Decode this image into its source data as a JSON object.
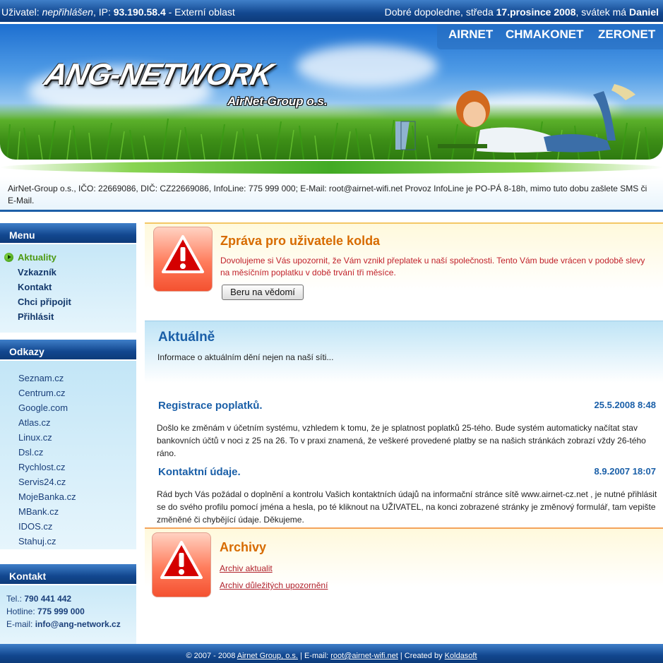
{
  "topbar": {
    "user_label": "Uživatel:",
    "user_value": "nepřihlášen",
    "ip_label": ", IP:",
    "ip_value": "93.190.58.4",
    "zone": "- Externí oblast",
    "greeting": "Dobré dopoledne, středa",
    "date": "17.prosince 2008",
    "nameday_label": ", svátek má",
    "nameday": "Daniel"
  },
  "header": {
    "logo": "ANG-NETWORK",
    "sublogo": "AirNet-Group o.s.",
    "nav": [
      "AIRNET",
      "CHMAKONET",
      "ZERONET"
    ]
  },
  "info": {
    "text": "AirNet-Group o.s., IČO: 22669086, DIČ: CZ22669086, InfoLine: 775 999 000; E-Mail: root@airnet-wifi.net Provoz InfoLine je PO-PÁ 8-18h, mimo tuto dobu zašlete SMS či E-Mail."
  },
  "sidebar": {
    "menu": {
      "title": "Menu",
      "items": [
        "Aktuality",
        "Vzkazník",
        "Kontakt",
        "Chci připojit",
        "Přihlásit"
      ]
    },
    "links": {
      "title": "Odkazy",
      "items": [
        "Seznam.cz",
        "Centrum.cz",
        "Google.com",
        "Atlas.cz",
        "Linux.cz",
        "Dsl.cz",
        "Rychlost.cz",
        "Servis24.cz",
        "MojeBanka.cz",
        "MBank.cz",
        "IDOS.cz",
        "Stahuj.cz"
      ]
    },
    "contact": {
      "title": "Kontakt",
      "tel_label": "Tel.:",
      "tel": "790 441 442",
      "hotline_label": "Hotline:",
      "hotline": "775 999 000",
      "email_label": "E-mail:",
      "email": "info@ang-network.cz"
    }
  },
  "alert": {
    "title": "Zpráva pro uživatele kolda",
    "text": "Dovolujeme si Vás upozornit, že Vám vznikl přeplatek u naší společnosti. Tento Vám bude vrácen v podobě slevy na měsíčním poplatku v době trvání tři měsíce.",
    "button": "Beru na vědomí"
  },
  "news": {
    "title": "Aktuálně",
    "lead": "Informace o aktuálním dění nejen na naší síti...",
    "items": [
      {
        "title": "Registrace poplatků.",
        "date": "25.5.2008 8:48",
        "text": "Došlo ke změnám v účetním systému, vzhledem k tomu, že je splatnost poplatků 25-tého. Bude systém automaticky načítat stav bankovních účtů v noci z 25 na 26. To v praxi znamená, že veškeré provedené platby se na našich stránkách zobrazí vždy 26-tého ráno."
      },
      {
        "title": "Kontaktní údaje.",
        "date": "8.9.2007 18:07",
        "text": "Rád bych Vás požádal o doplnění a kontrolu Vašich kontaktních údajů na informační stránce sítě www.airnet-cz.net , je nutné přihlásit se do svého profilu pomocí jména a hesla, po té kliknout na UŽIVATEL, na konci zobrazené stránky je změnový formulář, tam vepište změněné či chybějící údaje. Děkujeme."
      }
    ]
  },
  "archive": {
    "title": "Archivy",
    "links": [
      "Archiv aktualit",
      "Archiv důležitých upozornění"
    ]
  },
  "footer": {
    "copyright": "© 2007 - 2008",
    "org_link": "Airnet Group, o.s.",
    "sep1": "| E-mail:",
    "email_link": "root@airnet-wifi.net",
    "sep2": "| Created by",
    "creator_link": "Koldasoft"
  },
  "colors": {
    "bar_blue": "#12478f",
    "alert_title": "#d76b00",
    "alert_text": "#c0212b",
    "news_blue": "#1a5fa8",
    "active_green": "#4e9a14"
  }
}
